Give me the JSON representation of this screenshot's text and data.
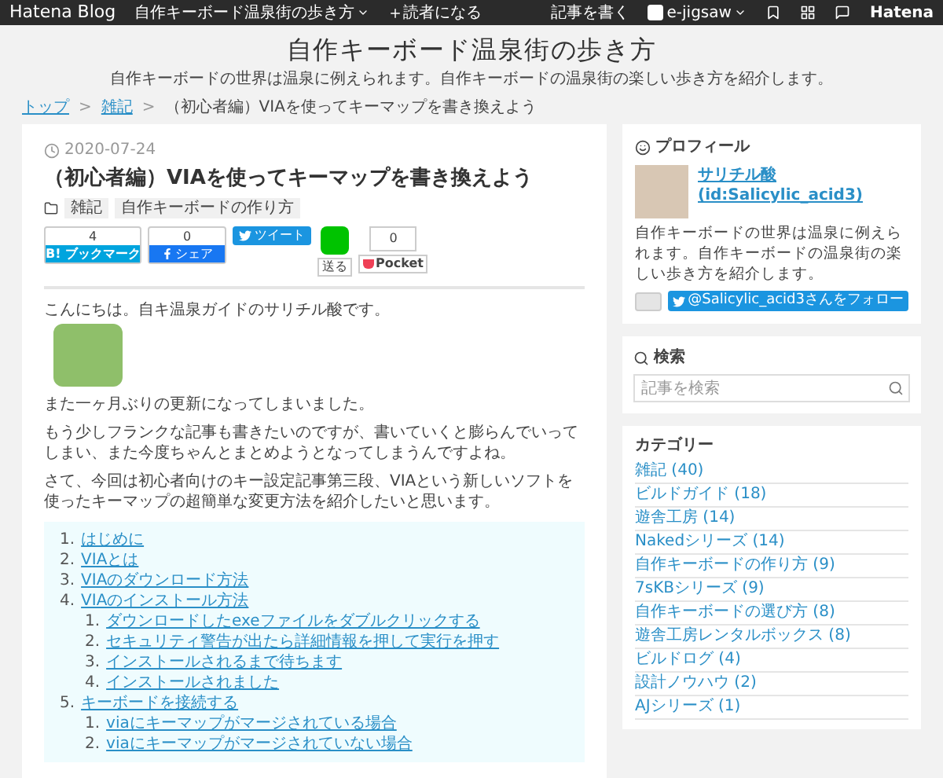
{
  "topbar": {
    "logo": "Hatena Blog",
    "blog_menu": "自作キーボード温泉街の歩き方",
    "subscribe": "読者になる",
    "write": "記事を書く",
    "user": "e-jigsaw",
    "brand": "Hatena"
  },
  "blog": {
    "title": "自作キーボード温泉街の歩き方",
    "tagline": "自作キーボードの世界は温泉に例えられます。自作キーボードの温泉街の楽しい歩き方を紹介します。"
  },
  "breadcrumb_separator": ">",
  "breadcrumb": [
    {
      "label": "トップ",
      "kind": "link"
    },
    {
      "label": "雑記",
      "kind": "link"
    },
    {
      "label": "（初心者編）VIAを使ってキーマップを書き換えよう",
      "kind": "current"
    }
  ],
  "article": {
    "date": "2020-07-24",
    "title": "（初心者編）VIAを使ってキーマップを書き換えよう",
    "tags": [
      "雑記",
      "自作キーボードの作り方"
    ],
    "share": {
      "bookmark_count": "4",
      "bookmark": "B! ブックマーク",
      "facebook_count": "0",
      "facebook": "シェア",
      "tweet": "ツイート",
      "line": "送る",
      "pocket_count": "0",
      "pocket": "Pocket"
    },
    "paragraphs": [
      "こんにちは。自キ温泉ガイドのサリチル酸です。",
      "また一ヶ月ぶりの更新になってしまいました。",
      "もう少しフランクな記事も書きたいのですが、書いていくと膨らんでいってしまい、また今度ちゃんとまとめようとなってしまうんですよね。",
      "さて、今回は初心者向けのキー設定記事第三段、VIAという新しいソフトを使ったキーマップの超簡単な変更方法を紹介したいと思います。"
    ],
    "toc": [
      {
        "num": "1.",
        "label": "はじめに"
      },
      {
        "num": "2.",
        "label": "VIAとは"
      },
      {
        "num": "3.",
        "label": "VIAのダウンロード方法"
      },
      {
        "num": "4.",
        "label": "VIAのインストール方法",
        "children": [
          {
            "num": "1.",
            "label": "ダウンロードしたexeファイルをダブルクリックする"
          },
          {
            "num": "2.",
            "label": "セキュリティ警告が出たら詳細情報を押して実行を押す"
          },
          {
            "num": "3.",
            "label": "インストールされるまで待ちます"
          },
          {
            "num": "4.",
            "label": "インストールされました"
          }
        ]
      },
      {
        "num": "5.",
        "label": "キーボードを接続する",
        "children": [
          {
            "num": "1.",
            "label": "viaにキーマップがマージされている場合"
          },
          {
            "num": "2.",
            "label": "viaにキーマップがマージされていない場合"
          }
        ]
      }
    ]
  },
  "sidebar": {
    "profile": {
      "heading": "プロフィール",
      "name": "サリチル酸",
      "id": "(id:Salicylic_acid3)",
      "description": "自作キーボードの世界は温泉に例えられます。自作キーボードの温泉街の楽しい歩き方を紹介します。",
      "follow": "@Salicylic_acid3さんをフォロー"
    },
    "search": {
      "heading": "検索",
      "placeholder": "記事を検索"
    },
    "categories": {
      "heading": "カテゴリー",
      "items": [
        "雑記 (40)",
        "ビルドガイド (18)",
        "遊舎工房 (14)",
        "Nakedシリーズ (14)",
        "自作キーボードの作り方 (9)",
        "7sKBシリーズ (9)",
        "自作キーボードの選び方 (8)",
        "遊舎工房レンタルボックス (8)",
        "ビルドログ (4)",
        "設計ノウハウ (2)",
        "AJシリーズ (1)"
      ]
    }
  }
}
